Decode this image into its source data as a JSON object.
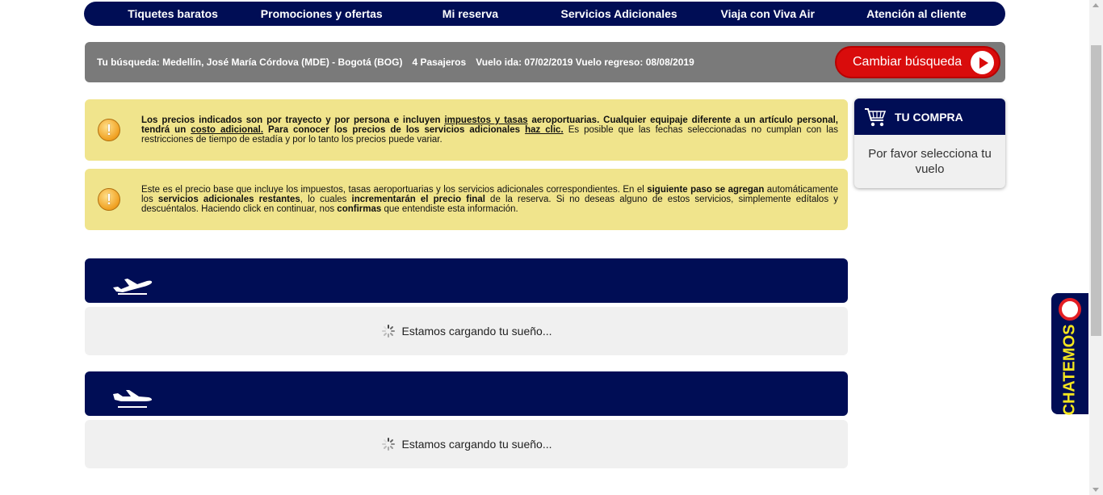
{
  "nav": {
    "items": [
      "Tiquetes baratos",
      "Promociones y ofertas",
      "Mi reserva",
      "Servicios Adicionales",
      "Viaja con Viva Air",
      "Atención al cliente"
    ]
  },
  "search": {
    "route": "Tu búsqueda: Medellín, José María Córdova (MDE) - Bogotá (BOG)",
    "passengers": "4 Pasajeros",
    "dates": "Vuelo ida: 07/02/2019 Vuelo regreso: 08/08/2019",
    "change_label": "Cambiar búsqueda"
  },
  "notice1": {
    "p1": "Los precios indicados son por trayecto y por persona e incluyen ",
    "p2": "impuestos y tasas",
    "p3": " aeroportuarias. Cualquier equipaje diferente a un artículo personal,",
    "p4": " tendrá un ",
    "p5": "costo adicional.",
    "p6": " Para conocer los precios de los servicios adicionales ",
    "p7": "haz clic.",
    "p8": "  Es posible que las fechas seleccionadas no cumplan con las restricciones de tiempo de estadía y por lo tanto los precios puede variar."
  },
  "notice2": {
    "p1": "Este es el precio base que incluye los impuestos, tasas aeroportuarias y los servicios adicionales correspondientes. En el ",
    "p2": "siguiente paso se agregan",
    "p3": " automáticamente los ",
    "p4": "servicios adicionales restantes",
    "p5": ", lo cuales ",
    "p6": "incrementarán el precio final",
    "p7": " de la reserva. Si no deseas alguno de estos servicios, simplemente edítalos y descuéntalos. Haciendo click en continuar, nos ",
    "p8": "confirmas",
    "p9": " que entendiste esta información."
  },
  "loading": {
    "text": "Estamos cargando tu sueño..."
  },
  "cart": {
    "title": "TU COMPRA",
    "message": "Por favor selecciona tu vuelo"
  },
  "chat": {
    "label": "CHATEMOS"
  },
  "colors": {
    "navy": "#000d55",
    "red": "#d90c0c",
    "notice_bg": "#f0e48c",
    "chat_text": "#f3e51e"
  }
}
